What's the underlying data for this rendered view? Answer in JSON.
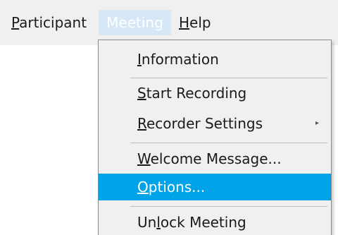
{
  "menubar": {
    "participant": {
      "pre": "",
      "key": "P",
      "post": "articipant"
    },
    "meeting": {
      "label": "Meeting"
    },
    "help": {
      "pre": "",
      "key": "H",
      "post": "elp"
    }
  },
  "meeting_menu": {
    "information": {
      "pre": "",
      "key": "I",
      "post": "nformation"
    },
    "start_recording": {
      "pre": "",
      "key": "S",
      "post": "tart Recording"
    },
    "recorder_settings": {
      "pre": "",
      "key": "R",
      "post": "ecorder Settings",
      "arrow": "▸"
    },
    "welcome_message": {
      "pre": "",
      "key": "W",
      "post": "elcome Message..."
    },
    "options": {
      "pre": "",
      "key": "O",
      "post": "ptions..."
    },
    "unlock_meeting": {
      "pre": "Un",
      "key": "l",
      "post": "ock Meeting"
    }
  },
  "colors": {
    "highlight": "#00a2e8",
    "menubar_open": "#d6e8f7",
    "menu_bg": "#f0f0f0"
  }
}
